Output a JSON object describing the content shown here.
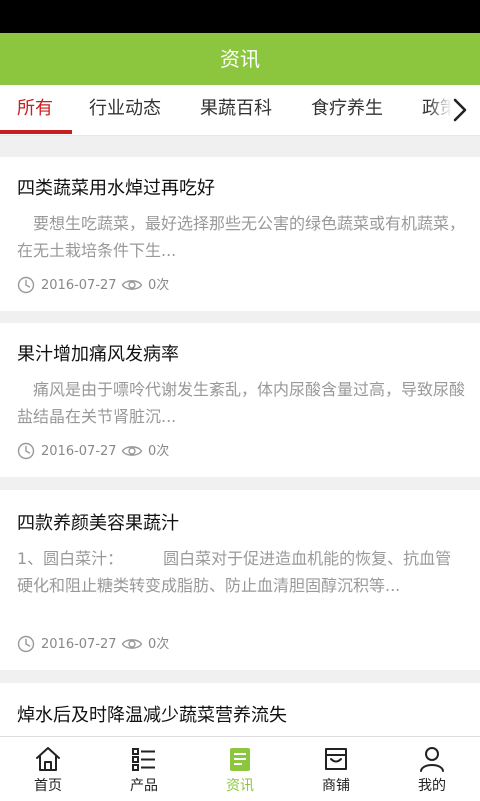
{
  "header": {
    "title": "资讯"
  },
  "tabs": [
    {
      "label": "所有",
      "active": true
    },
    {
      "label": "行业动态"
    },
    {
      "label": "果蔬百科"
    },
    {
      "label": "食疗养生"
    },
    {
      "label": "政策"
    }
  ],
  "articles": [
    {
      "title": "四类蔬菜用水焯过再吃好",
      "summary": "　要想生吃蔬菜，最好选择那些无公害的绿色蔬菜或有机蔬菜，在无土栽培条件下生...",
      "date": "2016-07-27",
      "views": "0次"
    },
    {
      "title": "果汁增加痛风发病率",
      "summary": "　痛风是由于嘌呤代谢发生紊乱，体内尿酸含量过高，导致尿酸盐结晶在关节肾脏沉...",
      "date": "2016-07-27",
      "views": "0次"
    },
    {
      "title": "四款养颜美容果蔬汁",
      "summary": "1、圆白菜汁：　　　圆白菜对于促进造血机能的恢复、抗血管硬化和阻止糖类转变成脂肪、防止血清胆固醇沉积等...",
      "date": "2016-07-27",
      "views": "0次"
    },
    {
      "title": "焯水后及时降温减少蔬菜营养流失"
    }
  ],
  "bottom_nav": [
    {
      "label": "首页",
      "icon": "home-icon"
    },
    {
      "label": "产品",
      "icon": "list-icon"
    },
    {
      "label": "资讯",
      "icon": "news-icon",
      "active": true
    },
    {
      "label": "商铺",
      "icon": "store-icon"
    },
    {
      "label": "我的",
      "icon": "user-icon"
    }
  ],
  "colors": {
    "brand": "#8cc63f",
    "active_tab": "#c81e1e"
  }
}
